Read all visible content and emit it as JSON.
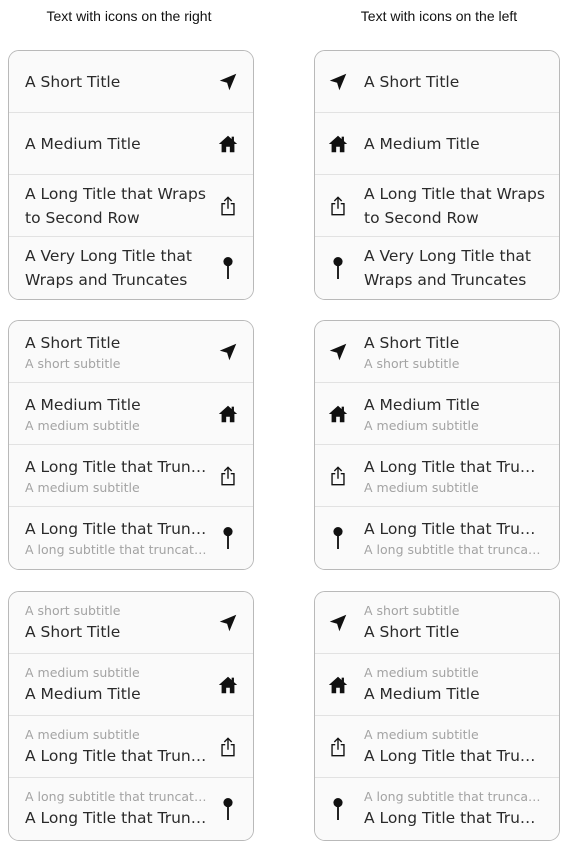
{
  "headers": {
    "right": "Text with icons on the right",
    "left": "Text with icons on the left"
  },
  "rows": [
    {
      "icon": "location-arrow-icon",
      "title": "A Short Title",
      "subtitle": "A short subtitle"
    },
    {
      "icon": "house-icon",
      "title": "A Medium Title",
      "subtitle": "A medium subtitle"
    },
    {
      "icon": "share-icon",
      "title": "A Long Title that Wraps to Second Row",
      "title_truncated": "A Long Title that Truncates",
      "subtitle": "A medium subtitle"
    },
    {
      "icon": "pin-icon",
      "title": "A Very Long Title that Wraps and Truncates",
      "title_truncated": "A Long Title that Truncates",
      "subtitle": "A long subtitle that truncates"
    }
  ]
}
